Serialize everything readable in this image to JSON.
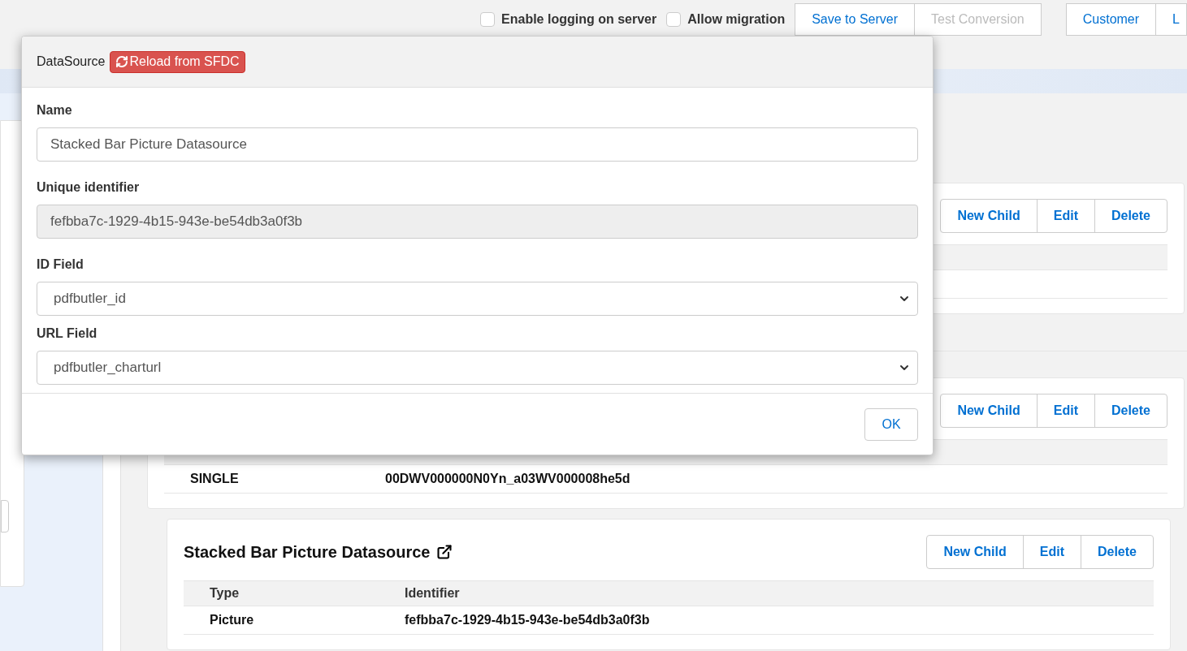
{
  "top_bar": {
    "checkboxes": [
      {
        "label": "Enable logging on server",
        "checked": false
      },
      {
        "label": "Allow migration",
        "checked": false
      }
    ],
    "buttons": [
      {
        "label": "Save to Server",
        "disabled": false
      },
      {
        "label": "Test Conversion",
        "disabled": true
      }
    ],
    "nav": [
      "Customer",
      "L"
    ]
  },
  "modal": {
    "title": "DataSource",
    "reload_button": "Reload from SFDC",
    "fields": [
      {
        "kind": "text",
        "label": "Name",
        "value": "Stacked Bar Picture Datasource"
      },
      {
        "kind": "readonly",
        "label": "Unique identifier",
        "value": "fefbba7c-1929-4b15-943e-be54db3a0f3b"
      },
      {
        "kind": "select",
        "label": "ID Field",
        "value": "pdfbutler_id"
      },
      {
        "kind": "select",
        "label": "URL Field",
        "value": "pdfbutler_charturl"
      }
    ],
    "ok_button": "OK"
  },
  "cards": [
    {
      "actions": [
        "New Child",
        "Edit",
        "Delete"
      ]
    },
    {
      "actions": [
        "New Child",
        "Edit",
        "Delete"
      ],
      "rows": [
        [
          "SINGLE",
          "00DWV000000N0Yn_a03WV000008he5d"
        ]
      ]
    },
    {
      "title": "Stacked Bar Picture Datasource",
      "actions": [
        "New Child",
        "Edit",
        "Delete"
      ],
      "columns": [
        "Type",
        "Identifier"
      ],
      "rows": [
        [
          "Picture",
          "fefbba7c-1929-4b15-943e-be54db3a0f3b"
        ]
      ]
    }
  ]
}
